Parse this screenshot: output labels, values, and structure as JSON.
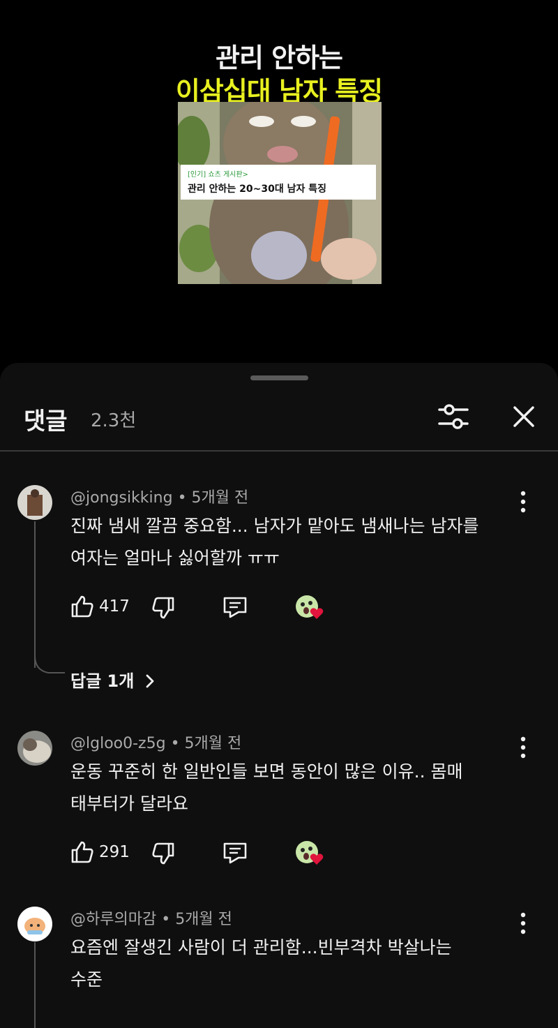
{
  "video": {
    "title_line1": "관리 안하는",
    "title_line2": "이삼십대 남자 특징",
    "card_tag": "[인기] 쇼츠 게시판>",
    "card_title": "관리 안하는 20~30대 남자 특징"
  },
  "comments_panel": {
    "title": "댓글",
    "count": "2.3천",
    "icons": {
      "filter": "sort-filter-icon",
      "close": "close-icon"
    }
  },
  "comments": [
    {
      "author": "@jongsikking",
      "time": "5개월 전",
      "text": "진짜 냄새 깔끔 중요함... 남자가 맡아도 냄새나는 남자를\n여자는 얼마나 싫어할까 ㅠㅠ",
      "likes": "417",
      "replies_label": "답글 1개"
    },
    {
      "author": "@lgloo0-z5g",
      "time": "5개월 전",
      "text": "운동 꾸준히 한 일반인들 보면 동안이 많은 이유.. 몸매\n태부터가 달라요",
      "likes": "291"
    },
    {
      "author": "@하루의마감",
      "time": "5개월 전",
      "text": "요즘엔 잘생긴 사람이 더 관리함...빈부격차 박살나는\n수준"
    }
  ],
  "meta_separator": "•",
  "colors": {
    "sheet_bg": "#0f0f0f",
    "title_yellow": "#e8f020",
    "heart": "#e0143c"
  }
}
